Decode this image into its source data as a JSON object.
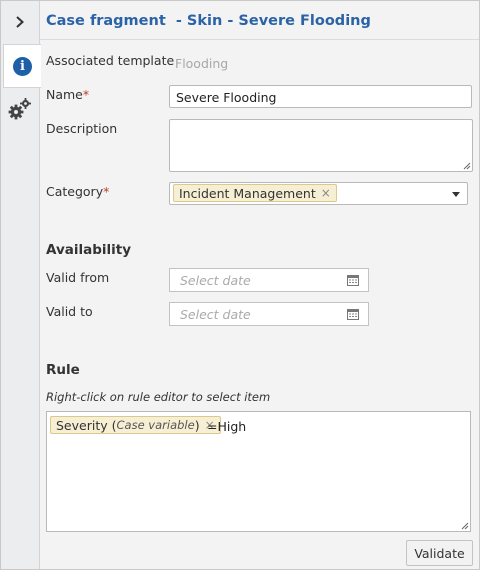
{
  "header": {
    "title": "Case fragment  - Skin - Severe Flooding"
  },
  "sidebar": {
    "collapse_icon": "chevron-right-icon",
    "tabs": [
      {
        "icon": "info-icon",
        "glyph": "i",
        "selected": true
      },
      {
        "icon": "gears-icon",
        "selected": false
      }
    ],
    "accent_color": "#1f5fa8"
  },
  "form": {
    "associated_template": {
      "label": "Associated template",
      "value": "Flooding"
    },
    "name": {
      "label": "Name",
      "required_mark": "*",
      "value": "Severe Flooding"
    },
    "description": {
      "label": "Description",
      "value": ""
    },
    "category": {
      "label": "Category",
      "required_mark": "*",
      "chip": "Incident Management",
      "chip_remove": "×"
    }
  },
  "availability": {
    "heading": "Availability",
    "valid_from": {
      "label": "Valid from",
      "placeholder": "Select date"
    },
    "valid_to": {
      "label": "Valid to",
      "placeholder": "Select date"
    }
  },
  "rule": {
    "heading": "Rule",
    "hint": "Right-click on rule editor to select item",
    "chip_name": "Severity",
    "chip_open": "(",
    "chip_type": "Case variable",
    "chip_close": ")",
    "chip_remove": "×",
    "operator_value": "=High"
  },
  "actions": {
    "validate_label": "Validate"
  },
  "colors": {
    "title": "#2b63a6",
    "required": "#c0392b",
    "chip_bg": "#f7efd3"
  }
}
